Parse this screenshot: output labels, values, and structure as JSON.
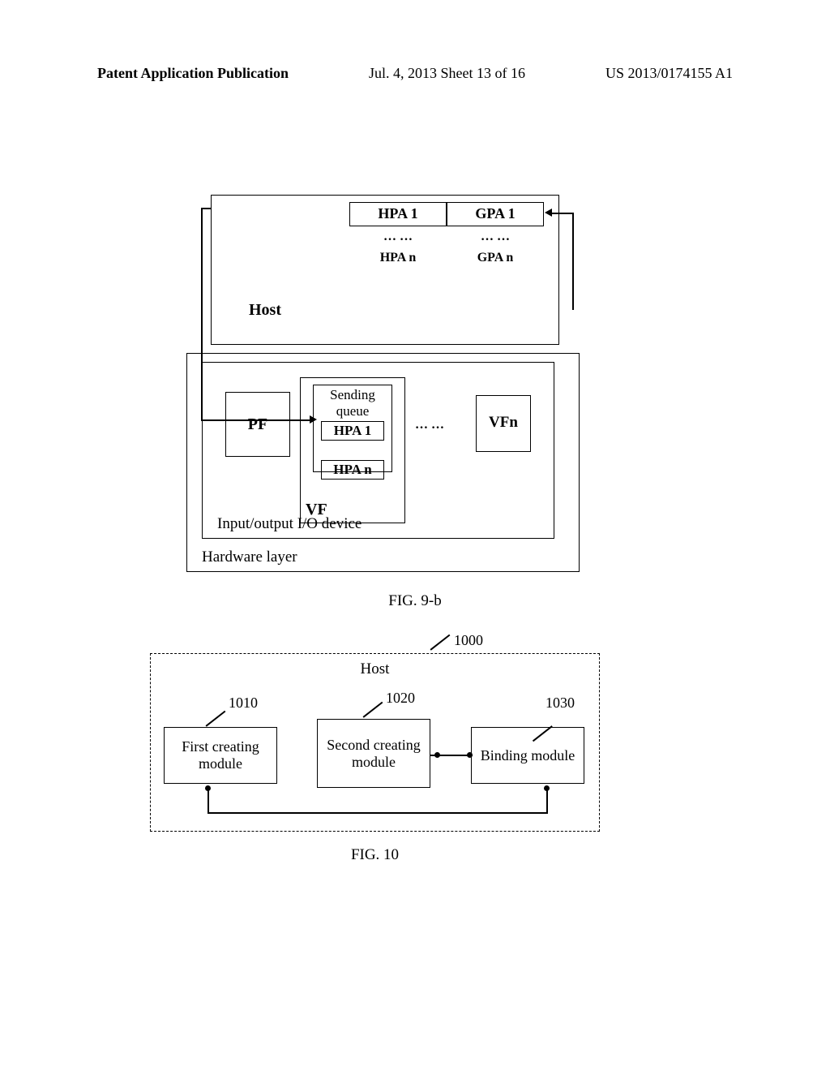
{
  "header": {
    "left": "Patent Application Publication",
    "center": "Jul. 4, 2013  Sheet 13 of 16",
    "right": "US 2013/0174155 A1"
  },
  "fig9b": {
    "host_label": "Host",
    "table": {
      "hpa1": "HPA 1",
      "gpa1": "GPA 1",
      "hpa_dots": "…  …",
      "gpa_dots": "…  …",
      "hpan": "HPA n",
      "gpan": "GPA n"
    },
    "pf": "PF",
    "vf_sendq": "Sending queue",
    "hpa1_cell": "HPA 1",
    "hpan_cell": "HPA n",
    "vf_label": "VF",
    "center_dots": "…  …",
    "vfn": "VFn",
    "io_label": "Input/output I/O device",
    "hw_label": "Hardware layer",
    "caption": "FIG. 9-b"
  },
  "fig10": {
    "ref_top": "1000",
    "ref1": "1010",
    "ref2": "1020",
    "ref3": "1030",
    "host": "Host",
    "mod1": "First creating module",
    "mod2": "Second creating module",
    "mod3": "Binding module",
    "caption": "FIG. 10"
  }
}
